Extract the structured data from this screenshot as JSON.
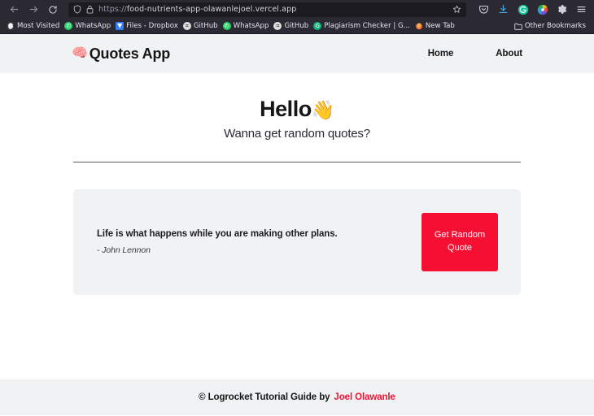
{
  "browser": {
    "back_label": "←",
    "forward_label": "→",
    "reload_label": "⟳",
    "url_scheme": "https://",
    "url_host": "food-nutrients-app-olawanlejoel.vercel.app",
    "shield_icon": "shield-icon",
    "lock_icon": "lock-icon",
    "bookmark_star_icon": "star-icon",
    "toolbar_icons": [
      {
        "name": "pocket-icon",
        "glyph": "◈"
      },
      {
        "name": "downloads-icon",
        "glyph": "⭳"
      },
      {
        "name": "grammarly-icon",
        "glyph": "G"
      },
      {
        "name": "color-extension-icon",
        "glyph": "◉"
      },
      {
        "name": "settings-gear-icon",
        "glyph": "⚙"
      },
      {
        "name": "menu-hamburger-icon",
        "glyph": "☰"
      }
    ],
    "bookmarks": [
      {
        "label": "Most Visited",
        "icon": "star-gear-icon"
      },
      {
        "label": "WhatsApp",
        "icon": "whatsapp-icon"
      },
      {
        "label": "Files - Dropbox",
        "icon": "dropbox-icon"
      },
      {
        "label": "GitHub",
        "icon": "github-icon"
      },
      {
        "label": "WhatsApp",
        "icon": "whatsapp-icon"
      },
      {
        "label": "GitHub",
        "icon": "github-icon"
      },
      {
        "label": "Plagiarism Checker | G...",
        "icon": "plagiarism-checker-icon"
      },
      {
        "label": "New Tab",
        "icon": "firefox-icon"
      }
    ],
    "other_bookmarks_label": "Other Bookmarks",
    "other_bookmarks_icon": "folder-icon"
  },
  "site": {
    "brand": {
      "emoji": "🧠",
      "emoji_name": "brain-icon",
      "name": "Quotes App"
    },
    "nav": [
      {
        "label": "Home"
      },
      {
        "label": "About"
      }
    ],
    "hero": {
      "title": "Hello",
      "emoji": "👋",
      "emoji_name": "waving-hand-icon",
      "subtitle": "Wanna get random quotes?"
    },
    "quote": {
      "text": "Life is what happens while you are making other plans.",
      "author": "- John Lennon",
      "button_label": "Get Random Quote"
    },
    "footer": {
      "text": "© Logrocket Tutorial Guide by",
      "author": "Joel Olawanle"
    }
  },
  "colors": {
    "accent_red": "#f50f32",
    "panel_gray": "#f1f2f4",
    "chrome_dark": "#2b2a33",
    "url_bar_dark": "#1c1b22"
  }
}
